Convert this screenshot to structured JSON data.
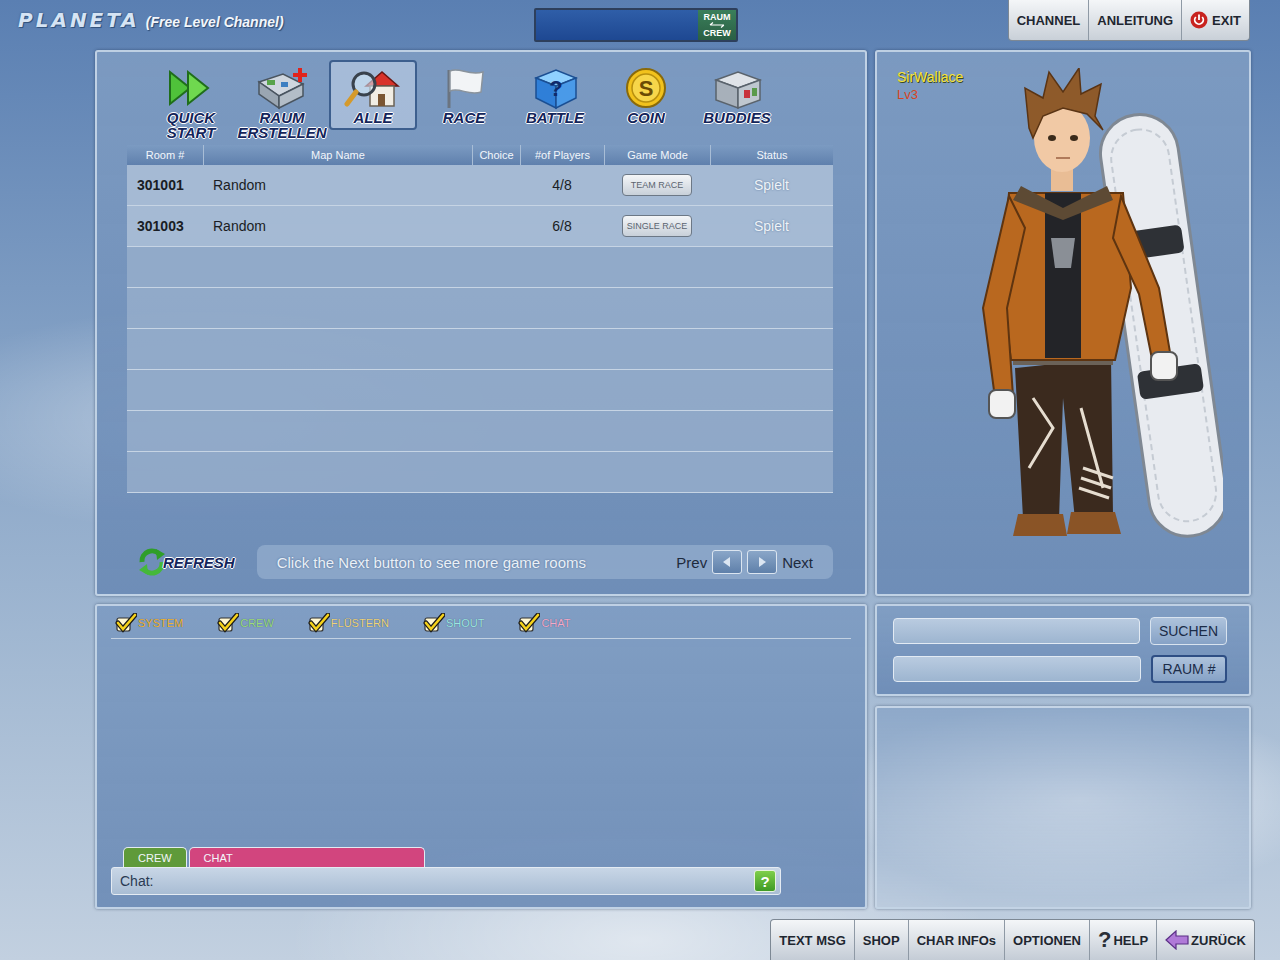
{
  "window": {
    "logo": "PLANETA",
    "channel": "(Free Level Channel)"
  },
  "top_toggle": {
    "labels": [
      "RAUM",
      "CREW"
    ],
    "level": 1
  },
  "top_menu": [
    {
      "label": "CHANNEL",
      "kind": "plain"
    },
    {
      "label": "ANLEITUNG",
      "kind": "plain"
    },
    {
      "label": "EXIT",
      "kind": "power"
    }
  ],
  "tools": [
    {
      "label": "QUICK START",
      "kind": "quick",
      "selected": false,
      "glyph": ""
    },
    {
      "label": "RAUM ERSTELLEN",
      "kind": "create",
      "selected": false,
      "glyph": ""
    },
    {
      "label": "ALLE",
      "kind": "all",
      "selected": true,
      "glyph": ""
    },
    {
      "label": "RACE",
      "kind": "race",
      "selected": false,
      "glyph": ""
    },
    {
      "label": "BATTLE",
      "kind": "battle",
      "selected": false,
      "glyph": "?"
    },
    {
      "label": "COIN",
      "kind": "coin",
      "selected": false,
      "glyph": "S"
    },
    {
      "label": "BUDDIES",
      "kind": "buddies",
      "selected": false,
      "glyph": ""
    }
  ],
  "table": {
    "columns": [
      "Room #",
      "Map Name",
      "Choice",
      "#of Players",
      "Game Mode",
      "Status"
    ],
    "rows": [
      {
        "room": "301001",
        "map": "Random",
        "choice": "",
        "players": "4/8",
        "mode": "TEAM RACE",
        "status": "Spielt"
      },
      {
        "room": "301003",
        "map": "Random",
        "choice": "",
        "players": "6/8",
        "mode": "SINGLE RACE",
        "status": "Spielt"
      }
    ]
  },
  "refresh": "REFRESH",
  "pager": {
    "hint": "Click the Next button to see more game rooms",
    "prev": "Prev",
    "next": "Next"
  },
  "character": {
    "name": "SirWallace",
    "level": "Lv3"
  },
  "chat": {
    "filters": [
      {
        "label": "SYSTEM",
        "checked": true,
        "color": "#f2b531"
      },
      {
        "label": "CREW",
        "checked": true,
        "color": "#9fdc7a"
      },
      {
        "label": "FLÜSTERN",
        "checked": true,
        "color": "#efd57a"
      },
      {
        "label": "SHOUT",
        "checked": true,
        "color": "#9fe6df"
      },
      {
        "label": "CHAT",
        "checked": true,
        "color": "#f4a9c8"
      }
    ],
    "tabs": [
      {
        "label": "CREW",
        "selected": false,
        "color": "#5f9a3a"
      },
      {
        "label": "CHAT",
        "selected": true,
        "color": "#d2457e"
      }
    ],
    "input_label": "Chat:",
    "input_value": "",
    "help": "?"
  },
  "search": {
    "fields": [
      {
        "value": ""
      },
      {
        "value": ""
      }
    ],
    "buttons": [
      {
        "label": "SUCHEN",
        "selected": false
      },
      {
        "label": "RAUM #",
        "selected": true
      }
    ]
  },
  "bottom_menu": [
    {
      "label": "TEXT MSG",
      "kind": "plain",
      "glyph": ""
    },
    {
      "label": "SHOP",
      "kind": "plain",
      "glyph": ""
    },
    {
      "label": "CHAR INFOs",
      "kind": "plain",
      "glyph": ""
    },
    {
      "label": "OPTIONEN",
      "kind": "plain",
      "glyph": ""
    },
    {
      "label": "HELP",
      "kind": "help",
      "glyph": "?"
    },
    {
      "label": "ZURÜCK",
      "kind": "back",
      "glyph": ""
    }
  ]
}
